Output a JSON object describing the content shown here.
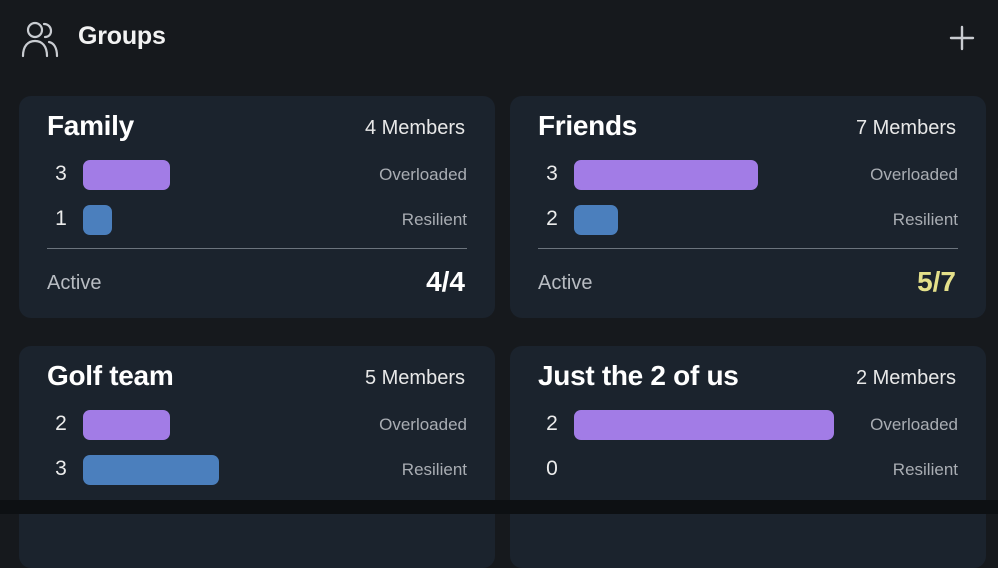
{
  "header": {
    "title": "Groups",
    "icon": "users-icon",
    "add_icon": "plus-icon"
  },
  "colors": {
    "background": "#16191d",
    "card": "#1b232d",
    "overloaded": "#a27ce6",
    "resilient": "#4b7fbd",
    "active_partial": "#e4e08a"
  },
  "groups": [
    {
      "name": "Family",
      "members": "4 Members",
      "overloaded": {
        "count": "3",
        "label": "Overloaded"
      },
      "resilient": {
        "count": "1",
        "label": "Resilient"
      },
      "active_label": "Active",
      "active_value": "4/4"
    },
    {
      "name": "Friends",
      "members": "7 Members",
      "overloaded": {
        "count": "3",
        "label": "Overloaded"
      },
      "resilient": {
        "count": "2",
        "label": "Resilient"
      },
      "active_label": "Active",
      "active_value": "5/7"
    },
    {
      "name": "Golf team",
      "members": "5 Members",
      "overloaded": {
        "count": "2",
        "label": "Overloaded"
      },
      "resilient": {
        "count": "3",
        "label": "Resilient"
      },
      "active_label": "",
      "active_value": ""
    },
    {
      "name": "Just the 2 of us",
      "members": "2 Members",
      "overloaded": {
        "count": "2",
        "label": "Overloaded"
      },
      "resilient": {
        "count": "0",
        "label": "Resilient"
      },
      "active_label": "",
      "active_value": ""
    }
  ]
}
